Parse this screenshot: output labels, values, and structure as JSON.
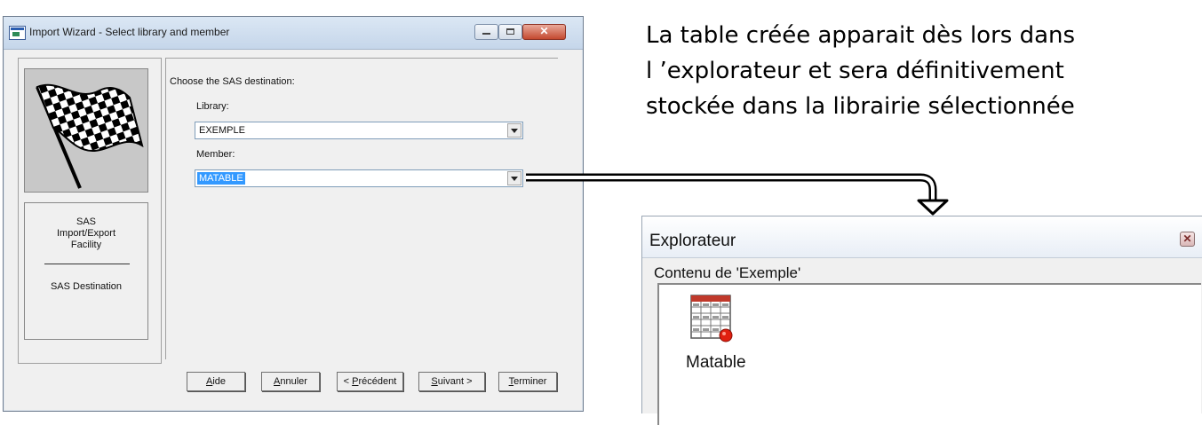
{
  "wizard": {
    "title": "Import Wizard - Select library and member",
    "left_panel": {
      "line1": "SAS",
      "line2": "Import/Export",
      "line3": "Facility",
      "line4": "SAS Destination"
    },
    "prompt": "Choose the SAS destination:",
    "library_label": "Library:",
    "library_value": "EXEMPLE",
    "member_label": "Member:",
    "member_value": "MATABLE",
    "buttons": {
      "aide": {
        "mnemonic": "A",
        "rest": "ide"
      },
      "annuler": {
        "mnemonic": "A",
        "rest": "nnuler"
      },
      "precedent": {
        "prefix": "< ",
        "mnemonic": "P",
        "rest": "récédent"
      },
      "suivant": {
        "mnemonic": "S",
        "rest": "uivant >"
      },
      "terminer": {
        "mnemonic": "T",
        "rest": "erminer"
      }
    }
  },
  "annotation": {
    "line1": "La table créée apparait dès lors dans",
    "line2": "l ’explorateur et sera définitivement",
    "line3": "stockée dans la librairie sélectionnée"
  },
  "explorer": {
    "title": "Explorateur",
    "subtitle": "Contenu de 'Exemple'",
    "item_label": "Matable"
  },
  "icons": {
    "app": "sas-window-icon",
    "flag": "checkered-flag-icon",
    "table": "sas-table-icon"
  }
}
